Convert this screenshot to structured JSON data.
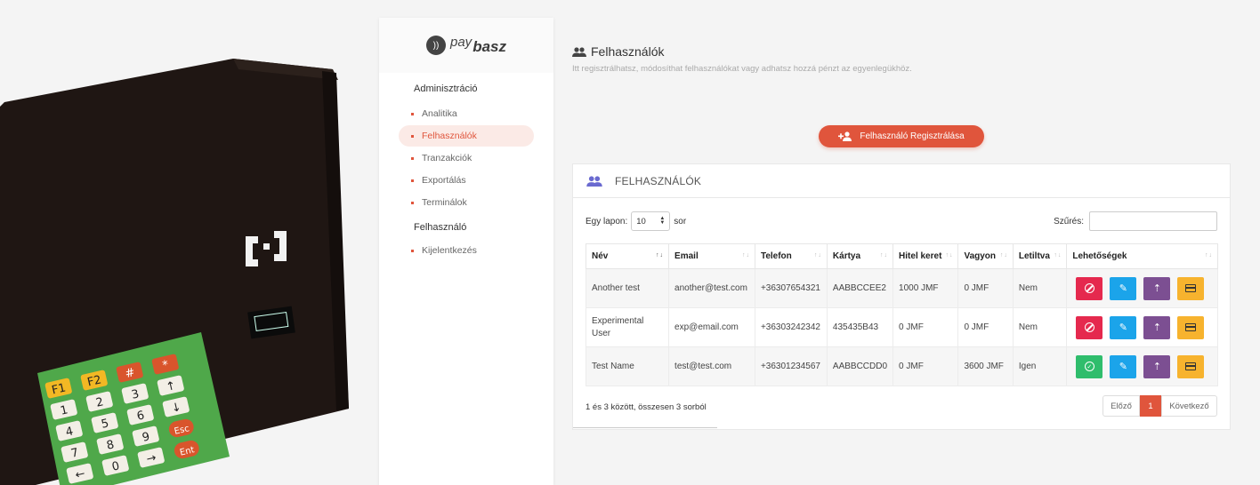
{
  "brand": {
    "pay": "pay",
    "name": "basz"
  },
  "sidebar": {
    "admin_title": "Adminisztráció",
    "admin_items": [
      {
        "label": "Analitika",
        "active": false
      },
      {
        "label": "Felhasználók",
        "active": true
      },
      {
        "label": "Tranzakciók",
        "active": false
      },
      {
        "label": "Exportálás",
        "active": false
      },
      {
        "label": "Terminálok",
        "active": false
      }
    ],
    "user_title": "Felhasználó",
    "user_items": [
      {
        "label": "Kijelentkezés",
        "active": false
      }
    ]
  },
  "header": {
    "title": "Felhasználók",
    "subtitle": "Itt regisztrálhatsz, módosíthat felhasználókat vagy adhatsz hozzá pénzt az egyenlegükhöz."
  },
  "register_button": "Felhasználó Regisztrálása",
  "card": {
    "title": "FELHASZNÁLÓK"
  },
  "controls": {
    "length_prefix": "Egy lapon:",
    "length_value": "10",
    "length_suffix": "sor",
    "filter_label": "Szűrés:"
  },
  "table": {
    "columns": [
      "Név",
      "Email",
      "Telefon",
      "Kártya",
      "Hitel keret",
      "Vagyon",
      "Letiltva",
      "Lehetőségek"
    ],
    "rows": [
      {
        "cells": [
          "Another test",
          "another@test.com",
          "+36307654321",
          "AABBCCEE2",
          "1000 JMF",
          "0 JMF",
          "Nem"
        ],
        "blocked": false
      },
      {
        "cells": [
          "Experimental User",
          "exp@email.com",
          "+36303242342",
          "435435B43",
          "0 JMF",
          "0 JMF",
          "Nem"
        ],
        "blocked": false
      },
      {
        "cells": [
          "Test Name",
          "test@test.com",
          "+36301234567",
          "AABBCCDD0",
          "0 JMF",
          "3600 JMF",
          "Igen"
        ],
        "blocked": true
      }
    ]
  },
  "footer": {
    "info": "1 és 3 között, összesen 3 sorból",
    "prev": "Előző",
    "page": "1",
    "next": "Következő"
  },
  "colors": {
    "accent": "#e0553c",
    "red": "#e5294e",
    "green": "#2fbd6c",
    "blue": "#1ba4ea",
    "purple": "#7c4f92",
    "yellow": "#f7b32e"
  },
  "device": {
    "keypad": [
      "F1",
      "F2",
      "#",
      "*",
      "1",
      "2",
      "3",
      "↑",
      "4",
      "5",
      "6",
      "↓",
      "7",
      "8",
      "9",
      "Esc",
      "←",
      "0",
      "→",
      "Ent"
    ]
  }
}
